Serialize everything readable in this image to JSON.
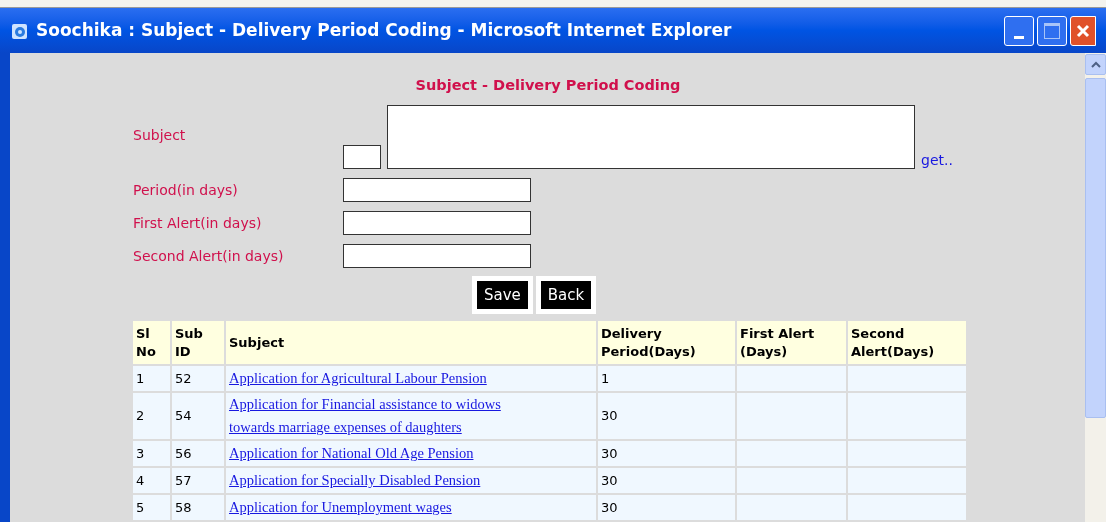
{
  "window": {
    "title": "Soochika : Subject - Delivery Period Coding - Microsoft Internet Explorer"
  },
  "form": {
    "heading": "Subject - Delivery Period Coding",
    "subject_label": "Subject",
    "get_link": "get..",
    "fields": [
      {
        "label": "Period(in days)"
      },
      {
        "label": "First Alert(in days)"
      },
      {
        "label": "Second Alert(in days)"
      }
    ],
    "buttons": [
      "Save",
      "Back"
    ]
  },
  "table": {
    "columns": [
      [
        "Sl",
        "No"
      ],
      [
        "Sub",
        "ID"
      ],
      [
        "Subject"
      ],
      [
        "Delivery",
        "Period(Days)"
      ],
      [
        "First Alert",
        "(Days)"
      ],
      [
        "Second",
        "Alert(Days)"
      ]
    ],
    "rows": [
      {
        "sl_no": "1",
        "sub_id": "52",
        "subject": [
          "Application for Agricultural Labour Pension"
        ],
        "delivery_period": "1"
      },
      {
        "sl_no": "2",
        "sub_id": "54",
        "subject": [
          "Application for Financial assistance to widows",
          "towards marriage expenses of daughters"
        ],
        "delivery_period": "30"
      },
      {
        "sl_no": "3",
        "sub_id": "56",
        "subject": [
          "Application for National Old Age Pension"
        ],
        "delivery_period": "30"
      },
      {
        "sl_no": "4",
        "sub_id": "57",
        "subject": [
          "Application for Specially Disabled Pension"
        ],
        "delivery_period": "30"
      },
      {
        "sl_no": "5",
        "sub_id": "58",
        "subject": [
          "Application for Unemployment wages"
        ],
        "delivery_period": "30"
      }
    ]
  }
}
